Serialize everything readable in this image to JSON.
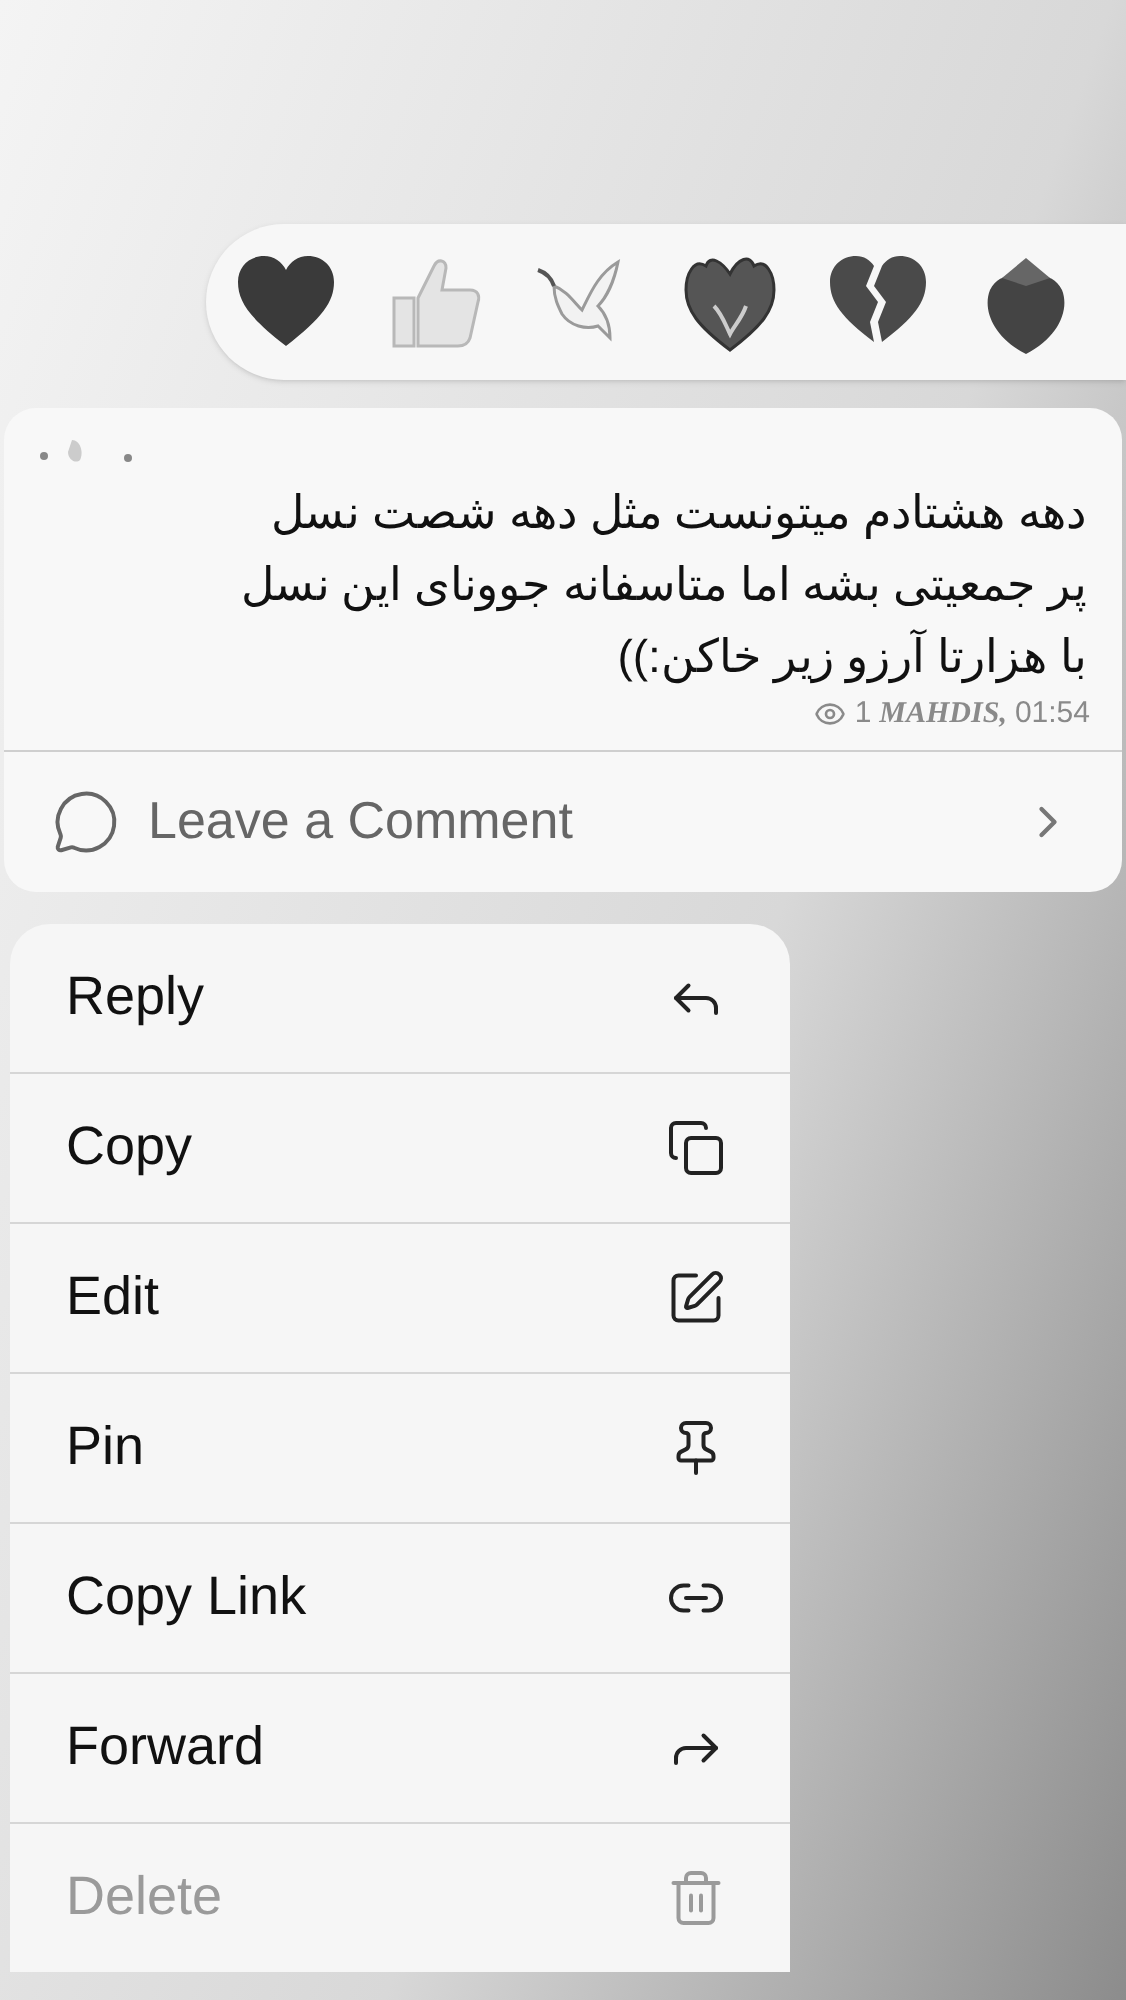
{
  "reactions": [
    {
      "kind": "heart"
    },
    {
      "kind": "thumbs_up"
    },
    {
      "kind": "dove"
    },
    {
      "kind": "heart_fire"
    },
    {
      "kind": "broken_heart"
    },
    {
      "kind": "strawberry"
    }
  ],
  "message": {
    "lines": [
      "دهه هشتادم میتونست مثل دهه شصت نسل",
      "پر جمعیتی بشه اما متاسفانه جوونای این نسل",
      "با هزارتا آرزو زیر خاکن:))"
    ],
    "views": "1",
    "author": "MAHDIS,",
    "time": "01:54"
  },
  "comment": {
    "label": "Leave a Comment"
  },
  "menu": [
    {
      "label": "Reply",
      "kind": "reply",
      "disabled": false
    },
    {
      "label": "Copy",
      "kind": "copy",
      "disabled": false
    },
    {
      "label": "Edit",
      "kind": "edit",
      "disabled": false
    },
    {
      "label": "Pin",
      "kind": "pin",
      "disabled": false
    },
    {
      "label": "Copy Link",
      "kind": "link",
      "disabled": false
    },
    {
      "label": "Forward",
      "kind": "forward",
      "disabled": false
    },
    {
      "label": "Delete",
      "kind": "delete",
      "disabled": true
    }
  ]
}
